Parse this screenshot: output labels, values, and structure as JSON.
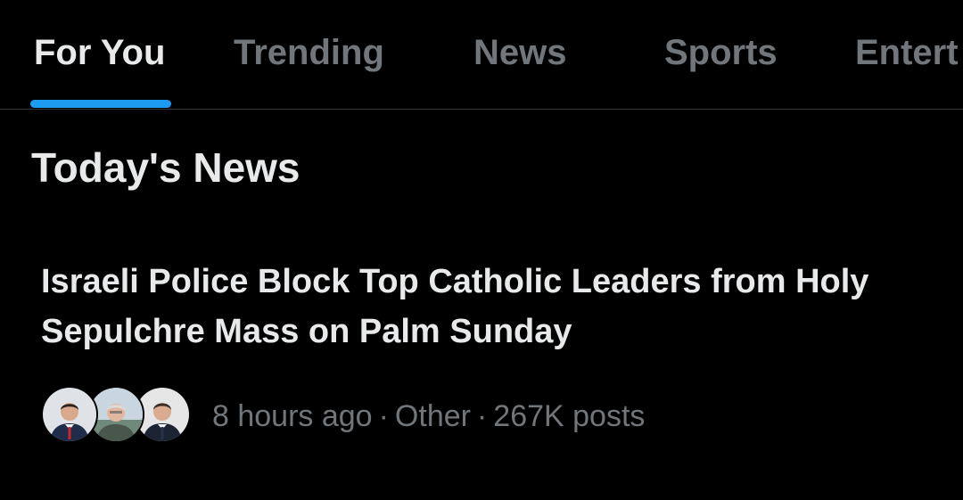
{
  "tabs": [
    {
      "label": "For You",
      "active": true
    },
    {
      "label": "Trending",
      "active": false
    },
    {
      "label": "News",
      "active": false
    },
    {
      "label": "Sports",
      "active": false
    },
    {
      "label": "Entert",
      "active": false
    }
  ],
  "section": {
    "title": "Today's News"
  },
  "story": {
    "headline": "Israeli Police Block Top Catholic Leaders from Holy Sepulchre Mass on Palm Sunday",
    "time": "8 hours ago",
    "category": "Other",
    "posts": "267K posts",
    "separator": "·",
    "avatars": [
      "avatar-person-1",
      "avatar-person-2",
      "avatar-person-3"
    ]
  },
  "colors": {
    "background": "#000000",
    "primary_text": "#e7e9ea",
    "secondary_text": "#71767b",
    "accent": "#1d9bf0",
    "divider": "#2f3336"
  }
}
